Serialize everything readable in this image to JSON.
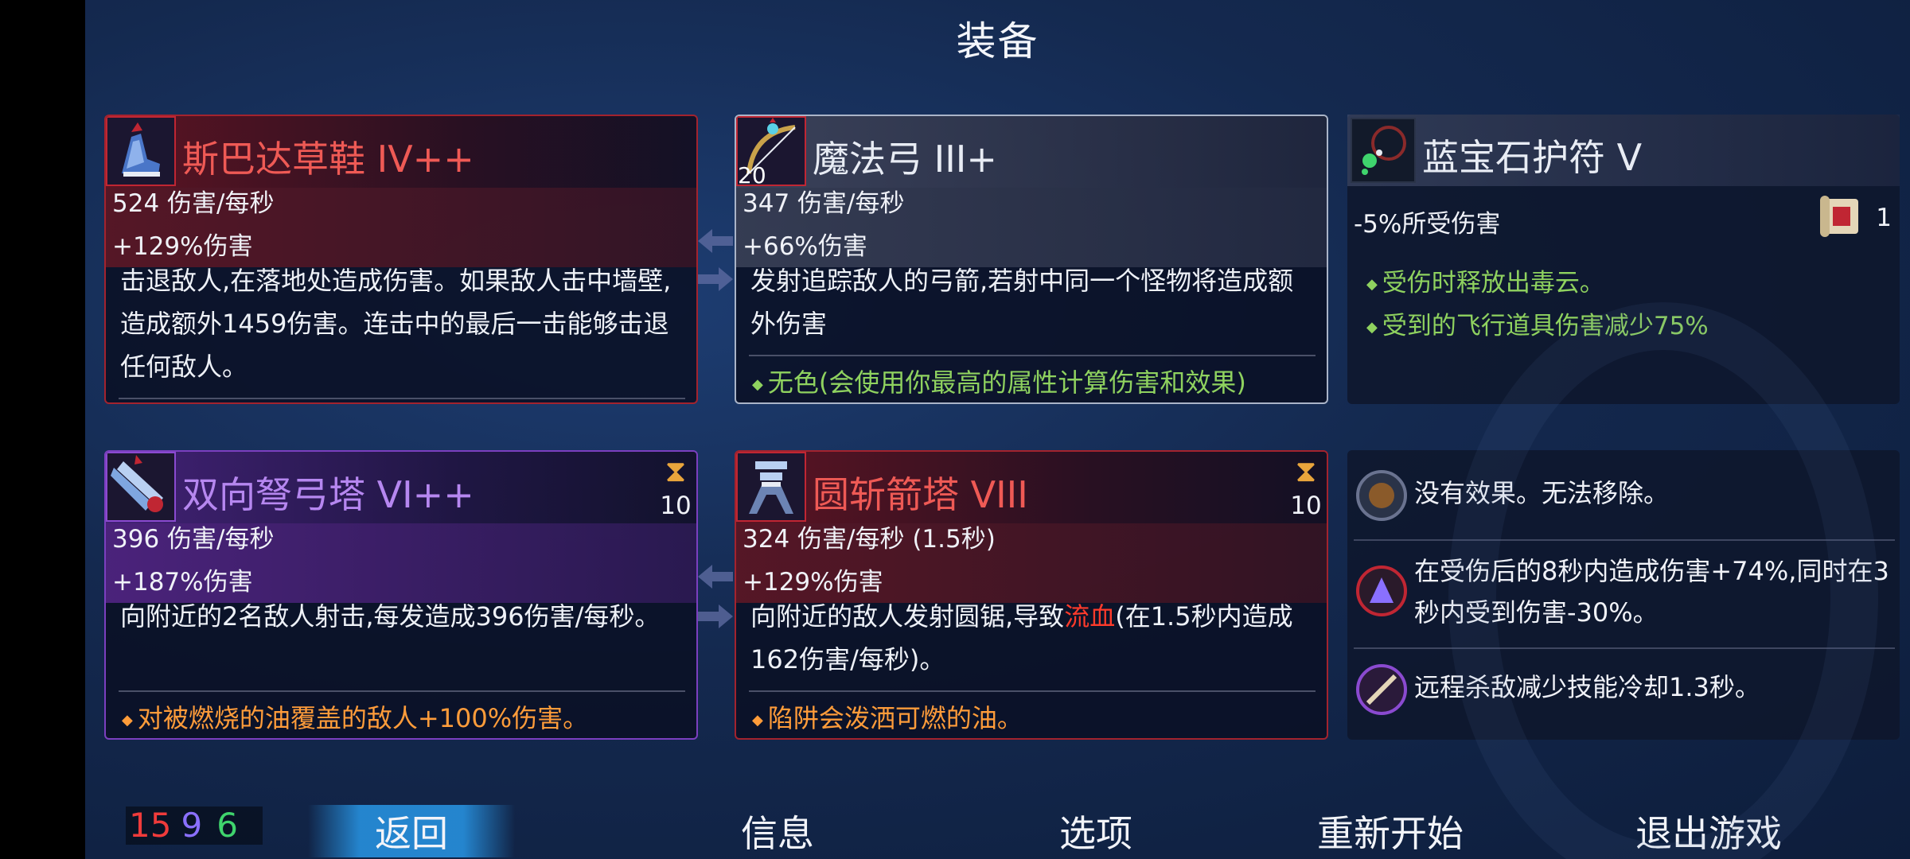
{
  "title": "装备",
  "items": [
    {
      "name": "斯巴达草鞋 IV++",
      "dps": "524 伤害/每秒",
      "damage": "+129%伤害",
      "description": "击退敌人,在落地处造成伤害。如果敌人击中墙壁,造成额外1459伤害。连击中的最后一击能够击退任何敌人。",
      "icon": "sandal-icon"
    },
    {
      "name": "魔法弓 III+",
      "icon_count": "20",
      "dps": "347 伤害/每秒",
      "damage": "+66%伤害",
      "description": "发射追踪敌人的弓箭,若射中同一个怪物将造成额外伤害",
      "note": "无色(会使用你最高的属性计算伤害和效果)",
      "icon": "bow-icon"
    },
    {
      "name": "双向弩弓塔 VI++",
      "timer": "10",
      "dps": "396 伤害/每秒",
      "damage": "+187%伤害",
      "description": "向附近的2名敌人射击,每发造成396伤害/每秒。",
      "note": "对被燃烧的油覆盖的敌人+100%伤害。",
      "icon": "crossbow-turret-icon"
    },
    {
      "name": "圆斩箭塔 VIII",
      "timer": "10",
      "dps": "324 伤害/每秒 (1.5秒)",
      "damage": "+129%伤害",
      "description_pre": "向附近的敌人发射圆锯,导致",
      "description_hl": "流血",
      "description_post": "(在1.5秒内造成162伤害/每秒)。",
      "note": "陷阱会泼洒可燃的油。",
      "icon": "sawblade-turret-icon"
    }
  ],
  "amulet": {
    "name": "蓝宝石护符 V",
    "stat": "-5%所受伤害",
    "scroll_count": "1",
    "effects": [
      "受伤时释放出毒云。",
      "受到的飞行道具伤害减少75%"
    ],
    "icon": "amulet-icon"
  },
  "mutations": [
    {
      "text": "没有效果。无法移除。",
      "icon": "mutation-empty-icon"
    },
    {
      "text": "在受伤后的8秒内造成伤害+74%,同时在3秒内受到伤害-30%。",
      "icon": "mutation-damage-icon"
    },
    {
      "text": "远程杀敌减少技能冷却1.3秒。",
      "icon": "mutation-cooldown-icon"
    }
  ],
  "stats": {
    "brutality": "15",
    "tactics": "9",
    "survival": "6"
  },
  "nav": {
    "back": "返回",
    "info": "信息",
    "options": "选项",
    "restart": "重新开始",
    "quit": "退出游戏"
  },
  "colors": {
    "red_border": "#a3232e",
    "purple_border": "#7b3fbf",
    "green_text": "#8fd25f",
    "orange_text": "#ff9c3a",
    "bleed": "#ff3b2b"
  }
}
